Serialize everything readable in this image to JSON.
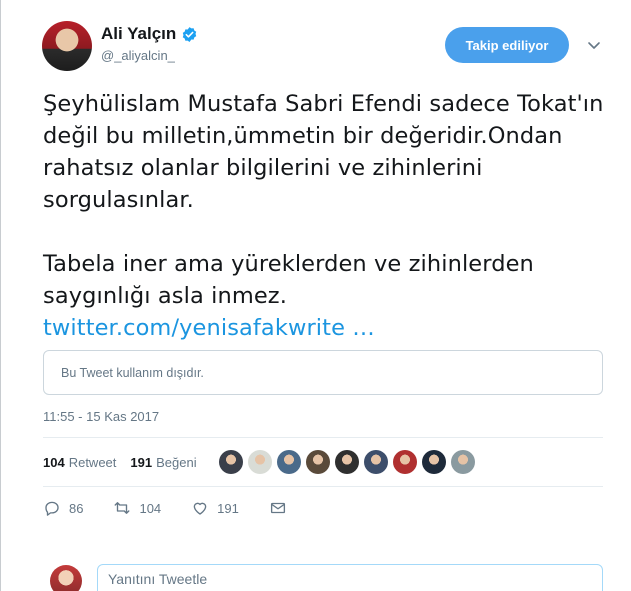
{
  "author": {
    "name": "Ali Yalçın",
    "handle": "@_aliyalcin_",
    "verified": true
  },
  "follow_button": {
    "label": "Takip ediliyor",
    "color": "#4aa0ec"
  },
  "tweet": {
    "paragraph1": "Şeyhülislam Mustafa Sabri Efendi sadece Tokat'ın değil bu milletin,ümmetin bir değeridir.Ondan rahatsız olanlar bilgilerini ve zihinlerini sorgulasınlar.",
    "paragraph2": "Tabela iner ama yüreklerden ve zihinlerden saygınlığı asla inmez.",
    "link": "twitter.com/yenisafakwrite …",
    "link_color": "#1b95e0"
  },
  "notice": "Bu Tweet kullanım dışıdır.",
  "timestamp": "11:55 - 15 Kas 2017",
  "stats": {
    "retweets_count": "104",
    "retweets_label": "Retweet",
    "likes_count": "191",
    "likes_label": "Beğeni"
  },
  "likers": [
    "#3a3f4a",
    "#d9dcd6",
    "#4a6a8a",
    "#5a4a3a",
    "#2f2f2f",
    "#3d4e6b",
    "#b03030",
    "#1e2a3a",
    "#8a9aa0"
  ],
  "actions": {
    "reply_count": "86",
    "retweet_count": "104",
    "like_count": "191"
  },
  "reply": {
    "placeholder": "Yanıtını Tweetle"
  }
}
